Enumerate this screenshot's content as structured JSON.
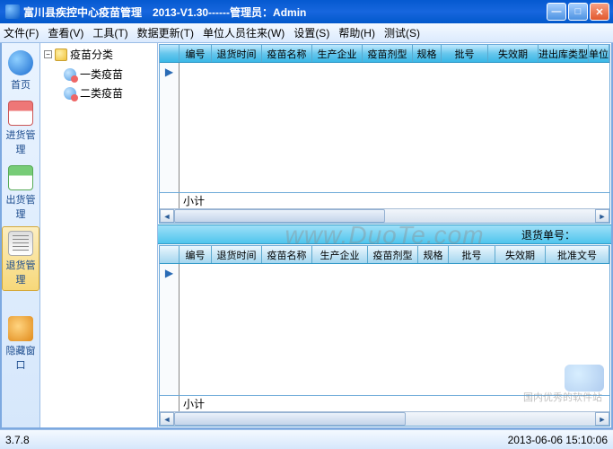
{
  "title": "富川县疾控中心疫苗管理　2013-V1.30------管理员：Admin",
  "menu": {
    "file": "文件(F)",
    "view": "查看(V)",
    "tool": "工具(T)",
    "data": "数据更新(T)",
    "unit": "单位人员往来(W)",
    "setting": "设置(S)",
    "help": "帮助(H)",
    "test": "测试(S)"
  },
  "sidebar": {
    "home": "首页",
    "in": "进货管理",
    "out": "出货管理",
    "ret": "退货管理",
    "hide": "隐藏窗口"
  },
  "tree": {
    "root": "疫苗分类",
    "leaf1": "一类疫苗",
    "leaf2": "二类疫苗"
  },
  "grid_top": {
    "cols": {
      "c0": "",
      "c1": "编号",
      "c2": "退货时间",
      "c3": "疫苗名称",
      "c4": "生产企业",
      "c5": "疫苗剂型",
      "c6": "规格",
      "c7": "批号",
      "c8": "失效期",
      "c9": "进出库类型",
      "c10": "单位"
    },
    "subtotal": "小计"
  },
  "batch_bar": {
    "label": "退货单号："
  },
  "grid_bot": {
    "cols": {
      "c0": "",
      "c1": "编号",
      "c2": "退货时间",
      "c3": "疫苗名称",
      "c4": "生产企业",
      "c5": "疫苗剂型",
      "c6": "规格",
      "c7": "批号",
      "c8": "失效期",
      "c9": "批准文号"
    },
    "subtotal": "小计"
  },
  "status": {
    "version": "3.7.8",
    "datetime": "2013-06-06 15:10:06"
  },
  "watermark": "www.DuoTe.com",
  "wm_footer": "国内优秀的软件站"
}
